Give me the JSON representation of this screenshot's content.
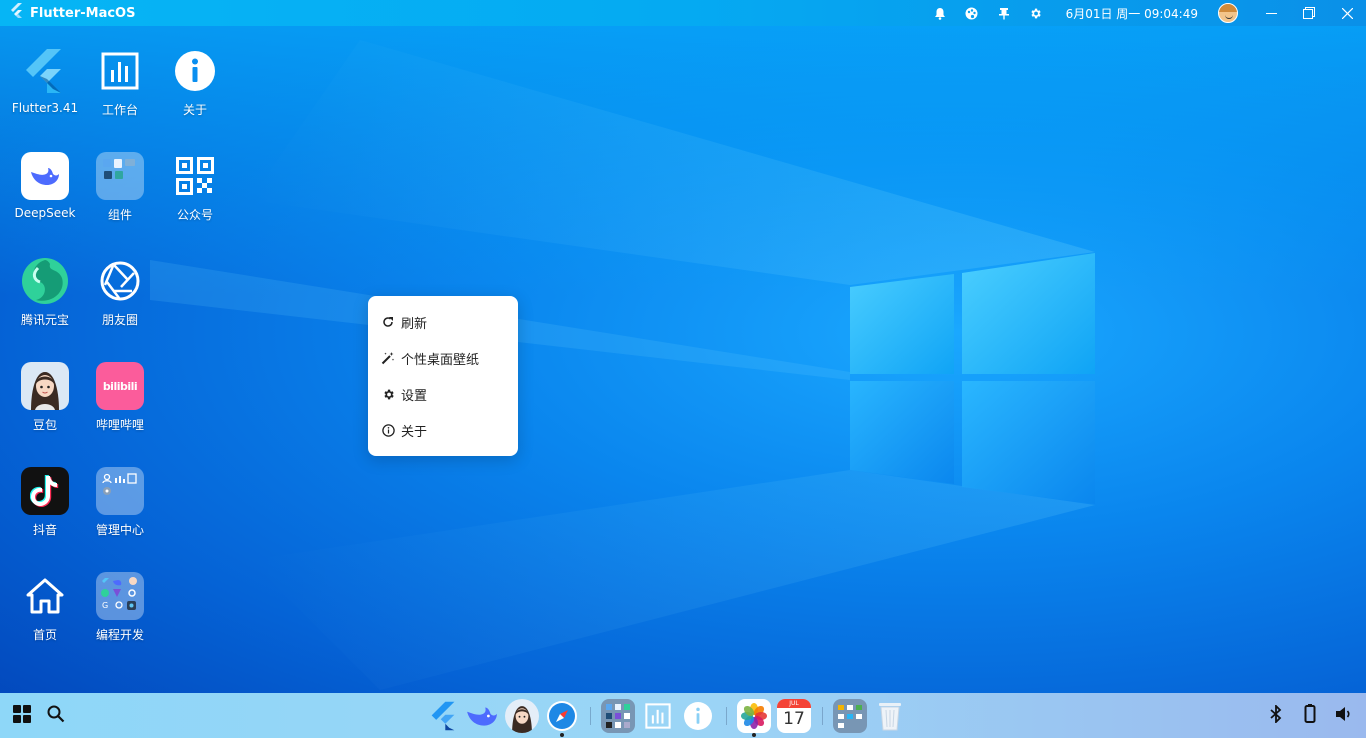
{
  "topbar": {
    "app_title": "Flutter-MacOS",
    "datetime": "6月01日 周一 09:04:49"
  },
  "desktop": {
    "icons": [
      {
        "label": "Flutter3.41",
        "icon": "flutter-icon"
      },
      {
        "label": "工作台",
        "icon": "dashboard-icon"
      },
      {
        "label": "关于",
        "icon": "info-icon"
      },
      {
        "label": "DeepSeek",
        "icon": "deepseek-icon"
      },
      {
        "label": "组件",
        "icon": "widgets-folder-icon"
      },
      {
        "label": "公众号",
        "icon": "qrcode-icon"
      },
      {
        "label": "腾讯元宝",
        "icon": "yuanbao-icon"
      },
      {
        "label": "朋友圈",
        "icon": "shutter-icon"
      },
      {
        "label": "豆包",
        "icon": "doubao-icon"
      },
      {
        "label": "哔哩哔哩",
        "icon": "bilibili-icon"
      },
      {
        "label": "抖音",
        "icon": "douyin-icon"
      },
      {
        "label": "管理中心",
        "icon": "admin-folder-icon"
      },
      {
        "label": "首页",
        "icon": "home-icon"
      },
      {
        "label": "编程开发",
        "icon": "dev-folder-icon"
      }
    ]
  },
  "context_menu": {
    "items": [
      {
        "label": "刷新",
        "icon": "refresh-icon"
      },
      {
        "label": "个性桌面壁纸",
        "icon": "magic-wand-icon"
      },
      {
        "label": "设置",
        "icon": "gear-icon"
      },
      {
        "label": "关于",
        "icon": "info-icon"
      }
    ]
  },
  "dock": {
    "calendar_month": "JUL",
    "calendar_day": "17",
    "bilibili_text": "bilibili"
  },
  "colors": {
    "topbar": "#06b5f5",
    "taskbar": "#9bd5f6",
    "wallpaper": "#0a86ee"
  }
}
